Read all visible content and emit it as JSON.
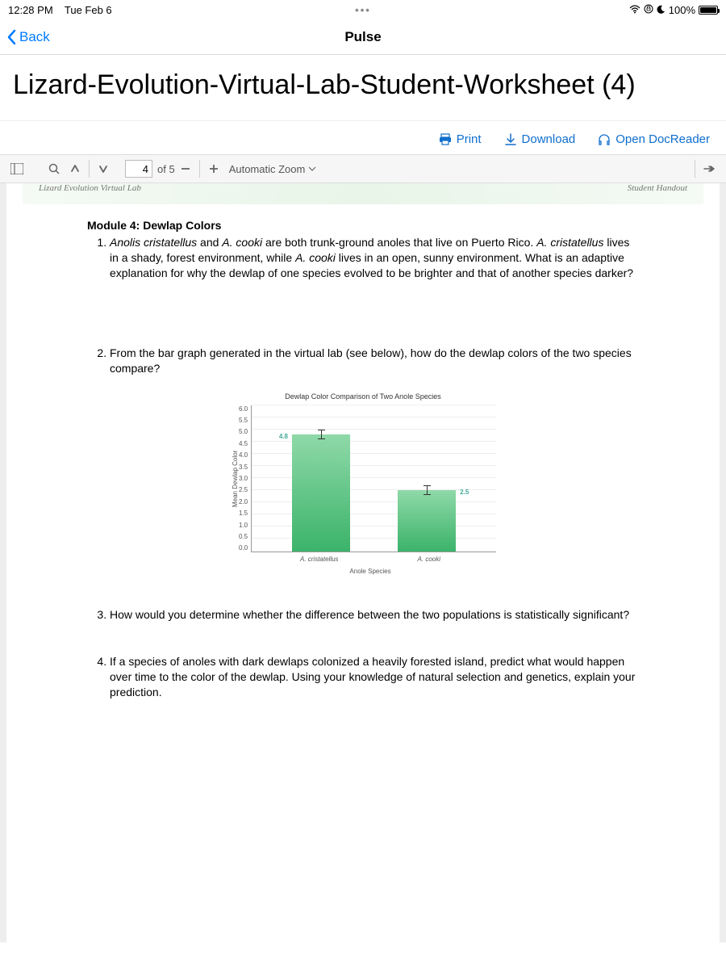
{
  "status": {
    "time": "12:28 PM",
    "date": "Tue Feb 6",
    "ellipsis": "•••",
    "battery_pct": "100%"
  },
  "nav": {
    "back_label": "Back",
    "title": "Pulse"
  },
  "doc": {
    "title": "Lizard-Evolution-Virtual-Lab-Student-Worksheet (4)"
  },
  "actions": {
    "print": "Print",
    "download": "Download",
    "open_docreader": "Open DocReader"
  },
  "pdf_toolbar": {
    "page_current": "4",
    "page_total": "of 5",
    "zoom_label": "Automatic Zoom"
  },
  "banner": {
    "left": "Lizard Evolution Virtual Lab",
    "right": "Student Handout"
  },
  "module": {
    "heading": "Module 4: Dewlap Colors",
    "q1_a": "Anolis cristatellus",
    "q1_b": " and ",
    "q1_c": "A. cooki",
    "q1_d": " are both trunk-ground anoles that live on Puerto Rico. ",
    "q1_e": "A. cristatellus",
    "q1_f": " lives in a shady, forest environment, while ",
    "q1_g": "A. cooki",
    "q1_h": " lives in an open, sunny environment. What is an adaptive explanation for why the dewlap of one species evolved to be brighter and that of another species darker?",
    "q2": "From the bar graph generated in the virtual lab (see below), how do the dewlap colors of the two species compare?",
    "q3": "How would you determine whether the difference between the two populations is statistically significant?",
    "q4": "If a species of anoles with dark dewlaps colonized a heavily forested island, predict what would happen over time to the color of the dewlap. Using your knowledge of natural selection and genetics, explain your prediction."
  },
  "chart_data": {
    "type": "bar",
    "title": "Dewlap Color Comparison of Two Anole Species",
    "xlabel": "Anole Species",
    "ylabel": "Mean Dewlap Color",
    "ylim": [
      0.0,
      6.0
    ],
    "yticks": [
      "6.0",
      "5.5",
      "5.0",
      "4.5",
      "4.0",
      "3.5",
      "3.0",
      "2.5",
      "2.0",
      "1.5",
      "1.0",
      "0.5",
      "0.0"
    ],
    "categories": [
      "A. cristatellus",
      "A. cooki"
    ],
    "values": [
      4.8,
      2.5
    ],
    "value_labels": [
      "4.8",
      "2.5"
    ]
  }
}
